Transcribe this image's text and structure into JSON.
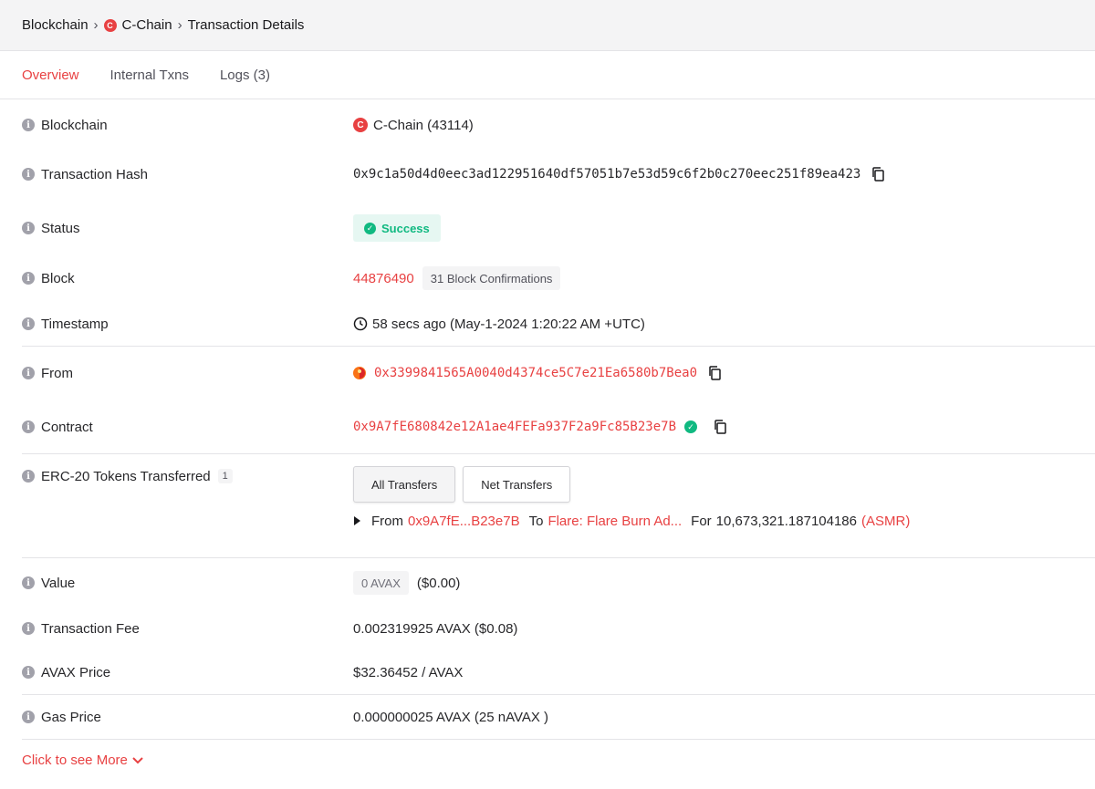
{
  "breadcrumb": {
    "root": "Blockchain",
    "chain_logo": "C",
    "chain": "C-Chain",
    "current": "Transaction Details",
    "separator": "›"
  },
  "tabs": [
    {
      "label": "Overview"
    },
    {
      "label": "Internal Txns"
    },
    {
      "label": "Logs (3)"
    }
  ],
  "info_glyph": "i",
  "fields": {
    "blockchain": {
      "label": "Blockchain",
      "value": "C-Chain (43114)"
    },
    "tx_hash": {
      "label": "Transaction Hash",
      "value": "0x9c1a50d4d0eec3ad122951640df57051b7e53d59c6f2b0c270eec251f89ea423"
    },
    "status": {
      "label": "Status",
      "value": "Success"
    },
    "block": {
      "label": "Block",
      "number": "44876490",
      "confirmations": "31 Block Confirmations"
    },
    "timestamp": {
      "label": "Timestamp",
      "value": "58 secs ago (May-1-2024 1:20:22 AM +UTC)"
    },
    "from": {
      "label": "From",
      "value": "0x3399841565A0040d4374ce5C7e21Ea6580b7Bea0"
    },
    "contract": {
      "label": "Contract",
      "value": "0x9A7fE680842e12A1ae4FEFa937F2a9Fc85B23e7B"
    },
    "erc20": {
      "label": "ERC-20 Tokens Transferred",
      "count": "1",
      "buttons": [
        "All Transfers",
        "Net Transfers"
      ],
      "transfer": {
        "from_label": "From",
        "from": "0x9A7fE...B23e7B",
        "to_label": "To",
        "to": "Flare: Flare Burn Ad...",
        "for_label": "For",
        "amount": "10,673,321.187104186",
        "token": "(ASMR)"
      }
    },
    "value": {
      "label": "Value",
      "amount": "0 AVAX",
      "usd": "($0.00)"
    },
    "fee": {
      "label": "Transaction Fee",
      "value": "0.002319925 AVAX ($0.08)"
    },
    "price": {
      "label": "AVAX Price",
      "value": "$32.36452 / AVAX"
    },
    "gas": {
      "label": "Gas Price",
      "value": "0.000000025 AVAX (25 nAVAX )"
    }
  },
  "see_more": "Click to see More",
  "colors": {
    "accent": "#e84142",
    "success": "#10b981"
  }
}
